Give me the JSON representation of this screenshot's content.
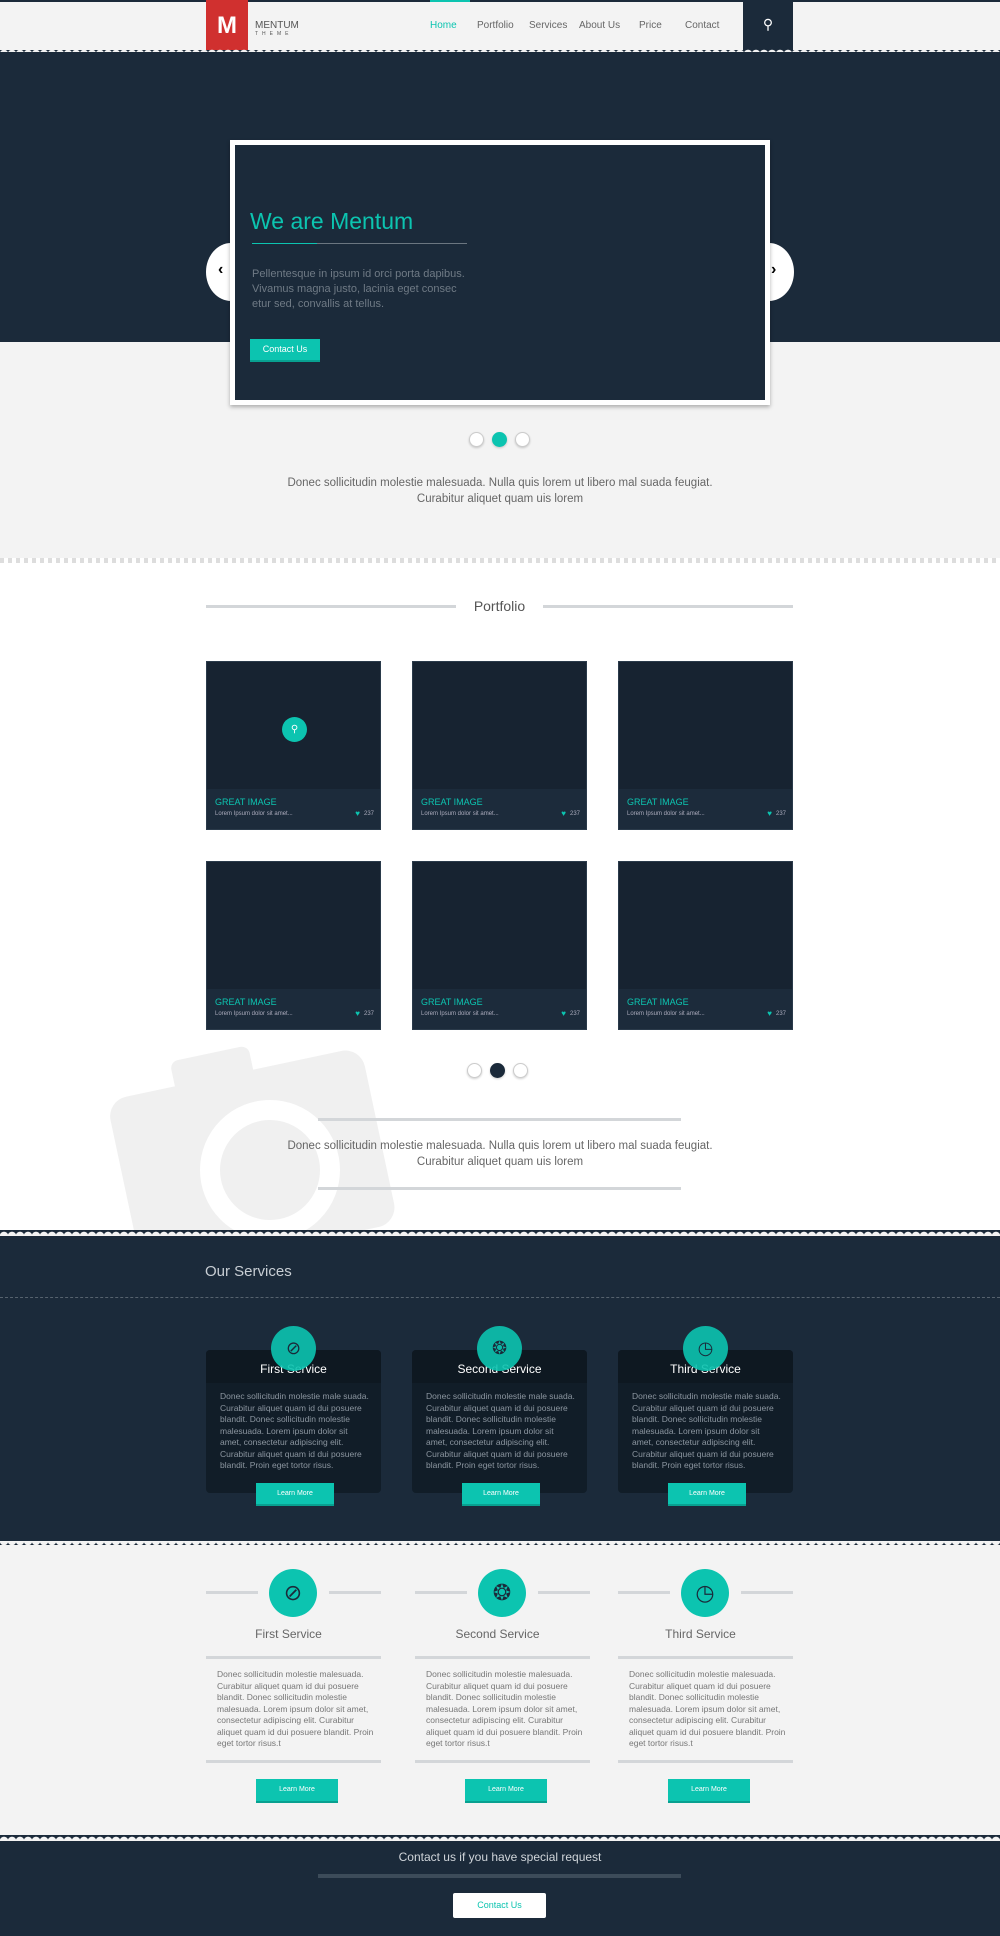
{
  "brand": {
    "name": "MENTUM",
    "sub": "THEME",
    "letter": "M"
  },
  "nav": {
    "items": [
      "Home",
      "Portfolio",
      "Services",
      "About Us",
      "Price",
      "Contact"
    ],
    "active": "Home",
    "search_icon": "search-icon"
  },
  "hero": {
    "title": "We are Mentum",
    "text": "Pellentesque in ipsum id orci porta dapibus. Vivamus magna justo, lacinia eget consec etur sed, convallis at tellus.",
    "button": "Contact Us",
    "active_slide": 2,
    "slides": 3
  },
  "intro": "Donec sollicitudin molestie malesuada. Nulla quis lorem ut libero mal suada feugiat. Curabitur aliquet quam uis lorem",
  "portfolio": {
    "heading": "Portfolio",
    "items": [
      {
        "title": "GREAT IMAGE",
        "desc": "Lorem Ipsum dolor sit amet...",
        "likes": "237"
      },
      {
        "title": "GREAT IMAGE",
        "desc": "Lorem Ipsum dolor sit amet...",
        "likes": "237"
      },
      {
        "title": "GREAT IMAGE",
        "desc": "Lorem Ipsum dolor sit amet...",
        "likes": "237"
      },
      {
        "title": "GREAT IMAGE",
        "desc": "Lorem Ipsum dolor sit amet...",
        "likes": "237"
      },
      {
        "title": "GREAT IMAGE",
        "desc": "Lorem Ipsum dolor sit amet...",
        "likes": "237"
      },
      {
        "title": "GREAT IMAGE",
        "desc": "Lorem Ipsum dolor sit amet...",
        "likes": "237"
      }
    ],
    "active_page": 2,
    "pages": 3,
    "text": "Donec sollicitudin molestie malesuada. Nulla quis lorem ut libero mal suada feugiat. Curabitur aliquet quam uis lorem"
  },
  "services_dark": {
    "heading": "Our Services",
    "items": [
      {
        "title": "First Service",
        "icon": "compass-icon",
        "text": "Donec sollicitudin molestie male suada. Curabitur aliquet quam id dui posuere blandit. Donec sollicitudin molestie malesuada. Lorem ipsum dolor sit amet, consectetur adipiscing elit. Curabitur aliquet quam id dui posuere blandit. Proin eget tortor risus.",
        "button": "Learn More"
      },
      {
        "title": "Second Service",
        "icon": "lifebuoy-icon",
        "text": "Donec sollicitudin molestie male suada. Curabitur aliquet quam id dui posuere blandit. Donec sollicitudin molestie malesuada. Lorem ipsum dolor sit amet, consectetur adipiscing elit. Curabitur aliquet quam id dui posuere blandit. Proin eget tortor risus.",
        "button": "Learn More"
      },
      {
        "title": "Third Service",
        "icon": "clock-icon",
        "text": "Donec sollicitudin molestie male suada. Curabitur aliquet quam id dui posuere blandit. Donec sollicitudin molestie malesuada. Lorem ipsum dolor sit amet, consectetur adipiscing elit. Curabitur aliquet quam id dui posuere blandit. Proin eget tortor risus.",
        "button": "Learn More"
      }
    ]
  },
  "services_light": {
    "items": [
      {
        "title": "First Service",
        "icon": "compass-icon",
        "text": "Donec sollicitudin molestie malesuada. Curabitur aliquet quam id dui posuere blandit. Donec sollicitudin molestie malesuada. Lorem ipsum dolor sit amet, consectetur adipiscing elit. Curabitur aliquet quam id dui posuere blandit. Proin eget tortor risus.t",
        "button": "Learn More"
      },
      {
        "title": "Second Service",
        "icon": "lifebuoy-icon",
        "text": "Donec sollicitudin molestie malesuada. Curabitur aliquet quam id dui posuere blandit. Donec sollicitudin molestie malesuada. Lorem ipsum dolor sit amet, consectetur adipiscing elit. Curabitur aliquet quam id dui posuere blandit. Proin eget tortor risus.t",
        "button": "Learn More"
      },
      {
        "title": "Third Service",
        "icon": "clock-icon",
        "text": "Donec sollicitudin molestie malesuada. Curabitur aliquet quam id dui posuere blandit. Donec sollicitudin molestie malesuada. Lorem ipsum dolor sit amet, consectetur adipiscing elit. Curabitur aliquet quam id dui posuere blandit. Proin eget tortor risus.t",
        "button": "Learn More"
      }
    ]
  },
  "footer": {
    "text": "Contact us if you have special request",
    "button": "Contact Us"
  },
  "colors": {
    "dark": "#1b2a3a",
    "accent": "#0cc4b0",
    "logo": "#d0302f"
  }
}
